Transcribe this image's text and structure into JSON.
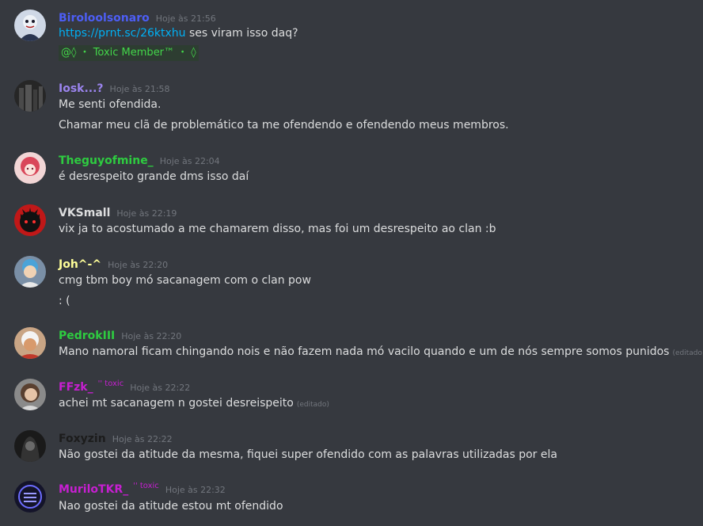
{
  "messages": [
    {
      "author": "Biroloolsonaro",
      "author_color": "#4d5ef5",
      "time": "Hoje às 21:56",
      "lines": [],
      "link": "https://prnt.sc/26ktxhu",
      "link_suffix": " ses viram isso daq?",
      "role_text": "@◊ ・ Toxic Member™ ・ ◊"
    },
    {
      "author": "Iosk...?",
      "author_color": "#9b84ee",
      "time": "Hoje às 21:58",
      "lines": [
        "Me senti ofendida.",
        "Chamar meu clã de problemático ta me ofendendo e ofendendo meus membros."
      ]
    },
    {
      "author": "Theguyofmine_",
      "author_color": "#2ecc40",
      "time": "Hoje às 22:04",
      "lines": [
        "é desrespeito grande dms isso daí"
      ]
    },
    {
      "author": "VKSmall",
      "author_color": "#dcddde",
      "time": "Hoje às 22:19",
      "lines": [
        "vix ja to acostumado a me chamarem disso, mas foi um desrespeito ao clan :b"
      ]
    },
    {
      "author": "Joh^-^",
      "author_color": "#ffff99",
      "time": "Hoje às 22:20",
      "lines": [
        "cmg tbm boy mó sacanagem com o clan pow",
        ": ("
      ]
    },
    {
      "author": "PedrokIII",
      "author_color": "#2ecc40",
      "time": "Hoje às 22:20",
      "lines": [
        "Mano namoral ficam chingando nois e não fazem nada mó vacilo quando e um de nós sempre somos punidos"
      ],
      "edited": "(editado)"
    },
    {
      "author": "FFzk_",
      "author_color": "#c71fd1",
      "tag": "'' toxic",
      "time": "Hoje às 22:22",
      "lines": [
        "achei mt sacanagem n gostei desreispeito"
      ],
      "edited": "(editado)"
    },
    {
      "author": "Foxyzin",
      "author_color": "#1c1c1c",
      "time": "Hoje às 22:22",
      "lines": [
        "Não gostei da atitude da mesma, fiquei super ofendido com as palavras utilizadas por ela"
      ]
    },
    {
      "author": "MuriloTKR_",
      "author_color": "#c71fd1",
      "tag": "'' toxic",
      "time": "Hoje às 22:32",
      "lines": [
        "Nao gostei da atitude estou mt ofendido"
      ]
    }
  ]
}
